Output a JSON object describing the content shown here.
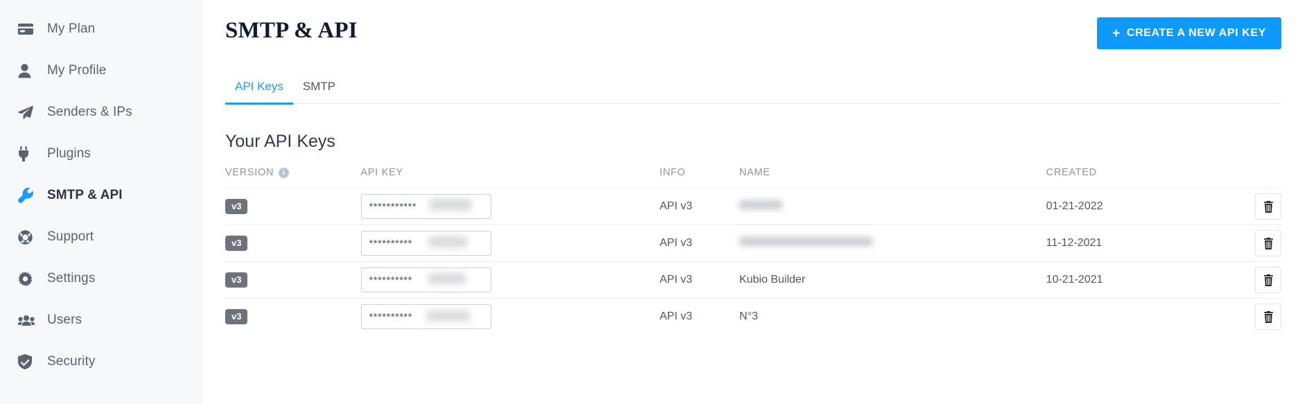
{
  "sidebar": {
    "items": [
      {
        "label": "My Plan",
        "icon": "credit-card-icon",
        "active": false
      },
      {
        "label": "My Profile",
        "icon": "user-icon",
        "active": false
      },
      {
        "label": "Senders & IPs",
        "icon": "paper-plane-icon",
        "active": false
      },
      {
        "label": "Plugins",
        "icon": "plug-icon",
        "active": false
      },
      {
        "label": "SMTP & API",
        "icon": "wrench-icon",
        "active": true
      },
      {
        "label": "Support",
        "icon": "lifebuoy-icon",
        "active": false
      },
      {
        "label": "Settings",
        "icon": "gear-icon",
        "active": false
      },
      {
        "label": "Users",
        "icon": "users-icon",
        "active": false
      },
      {
        "label": "Security",
        "icon": "shield-check-icon",
        "active": false
      }
    ]
  },
  "header": {
    "title": "SMTP & API",
    "create_button": "CREATE A NEW API KEY",
    "create_button_plus": "+"
  },
  "tabs": [
    {
      "label": "API Keys",
      "active": true
    },
    {
      "label": "SMTP",
      "active": false
    }
  ],
  "section": {
    "title": "Your API Keys",
    "columns": {
      "version": "VERSION",
      "api_key": "API KEY",
      "info": "INFO",
      "name": "NAME",
      "created": "CREATED",
      "action": ""
    },
    "version_info_icon": "i"
  },
  "rows": [
    {
      "version": "v3",
      "key_mask": "***********",
      "key_blurred": true,
      "info": "API v3",
      "name": "",
      "name_blurred": true,
      "name_blur_width": 62,
      "created": "01-21-2022",
      "delete_icon": "trash-icon"
    },
    {
      "version": "v3",
      "key_mask": "**********",
      "key_blurred": true,
      "info": "API v3",
      "name": "",
      "name_blurred": true,
      "name_blur_width": 192,
      "created": "11-12-2021",
      "delete_icon": "trash-icon"
    },
    {
      "version": "v3",
      "key_mask": "**********",
      "key_blurred": true,
      "info": "API v3",
      "name": "Kubio Builder",
      "name_blurred": false,
      "name_blur_width": 0,
      "created": "10-21-2021",
      "delete_icon": "trash-icon"
    },
    {
      "version": "v3",
      "key_mask": "**********",
      "key_blurred": true,
      "info": "API v3",
      "name": "N°3",
      "name_blurred": false,
      "name_blur_width": 0,
      "created": "",
      "delete_icon": "trash-icon"
    }
  ],
  "colors": {
    "accent": "#0e9afd",
    "tab_active": "#1a9bfc",
    "sidebar_bg": "#f7f8fa",
    "badge_bg": "#6d727c",
    "title": "#0f1b33",
    "muted_text": "#8b95a5"
  }
}
